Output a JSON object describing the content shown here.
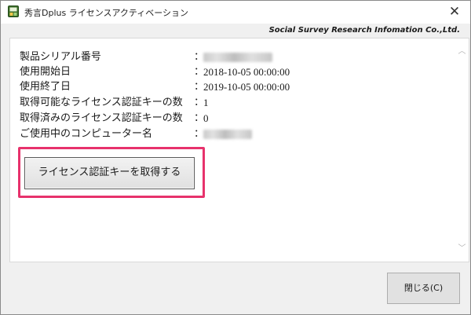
{
  "window": {
    "title": "秀言Dplus ライセンスアクティベーション",
    "close_glyph": "✕",
    "company": "Social Survey Research Infomation Co.,Ltd."
  },
  "info": {
    "rows": [
      {
        "label": "製品シリアル番号",
        "value": ""
      },
      {
        "label": "使用開始日",
        "value": "2018-10-05 00:00:00"
      },
      {
        "label": "使用終了日",
        "value": "2019-10-05 00:00:00"
      },
      {
        "label": "取得可能なライセンス認証キーの数",
        "value": "1"
      },
      {
        "label": "取得済みのライセンス認証キーの数",
        "value": "0"
      },
      {
        "label": "ご使用中のコンピューター名",
        "value": ""
      }
    ],
    "colon": "："
  },
  "buttons": {
    "get_key": "ライセンス認証キーを取得する",
    "close": "閉じる(C)"
  },
  "scrollbar": {
    "up_glyph": "︿",
    "down_glyph": "﹀"
  },
  "colors": {
    "highlight": "#e7326c",
    "window_bg": "#f0f0f0"
  },
  "icons": {
    "app": "app-logo-icon"
  }
}
